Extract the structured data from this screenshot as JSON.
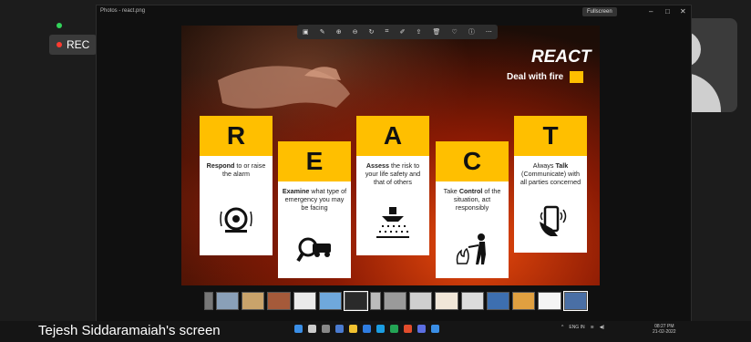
{
  "meeting": {
    "rec_label": "REC",
    "screen_owner_label": "Tejesh Siddaramaiah's screen"
  },
  "window": {
    "title": "Photos - react.png",
    "fullscreen_label": "Fullscreen"
  },
  "slide": {
    "title": "REACT",
    "subtitle": "Deal with fire",
    "accent_color": "#ffbf00",
    "cards": [
      {
        "letter": "R",
        "bold": "Respond",
        "text": " to or raise the alarm",
        "icon": "alarm-bell-icon"
      },
      {
        "letter": "E",
        "bold": "Examine",
        "text": " what type of emergency you may be facing",
        "icon": "magnifier-vehicle-icon"
      },
      {
        "letter": "A",
        "bold": "Assess",
        "text": " the risk to your life safety and that of others",
        "icon": "sprinkler-icon"
      },
      {
        "letter": "C",
        "text_pre": "Take ",
        "bold": "Control",
        "text": " of the situation, act responsibly",
        "icon": "fire-extinguisher-person-icon"
      },
      {
        "letter": "T",
        "text_pre": "Always ",
        "bold": "Talk",
        "text": " (Communicate) with all parties concerned",
        "icon": "phone-call-icon"
      }
    ]
  },
  "taskbar": {
    "tray_lang": "ENG IN",
    "clock_time": "08:27 PM",
    "clock_date": "21-02-2022"
  }
}
